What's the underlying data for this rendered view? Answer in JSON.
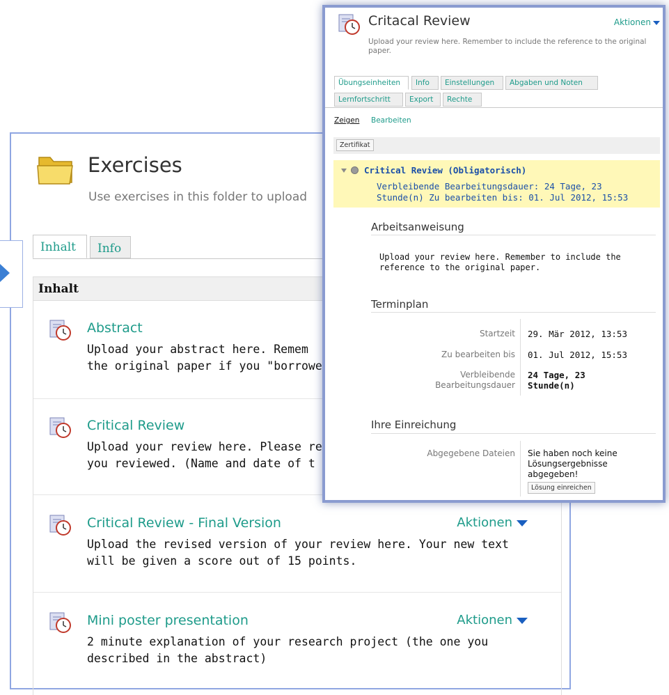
{
  "back_window": {
    "title": "Exercises",
    "description": "Use exercises in this folder to upload",
    "tabs": [
      {
        "label": "Inhalt",
        "active": true
      },
      {
        "label": "Info",
        "active": false
      }
    ],
    "list_header": "Inhalt",
    "items": [
      {
        "title": "Abstract",
        "description": "Upload your abstract here. Remem\nthe original paper if you \"borrowed\"",
        "actions": ""
      },
      {
        "title": "Critical Review",
        "description": "Upload your review here. Please re\nyou reviewed. (Name and date of t",
        "actions": ""
      },
      {
        "title": "Critical Review - Final Version",
        "description": "Upload the revised version of your review here. Your new text will be given a score out of 15 points.",
        "actions": "Aktionen"
      },
      {
        "title": "Mini poster presentation",
        "description": "2 minute explanation of your research project (the one you described in the abstract)",
        "actions": "Aktionen"
      }
    ]
  },
  "front_window": {
    "title": "Critacal Review",
    "actions_label": "Aktionen",
    "description": "Upload your review here. Remember to include the reference to the original paper.",
    "tabs_row1": [
      "Übungseinheiten",
      "Info",
      "Einstellungen",
      "Abgaben und Noten"
    ],
    "tabs_row2": [
      "Lernfortschritt",
      "Export",
      "Rechte"
    ],
    "subnav": {
      "show": "Zeigen",
      "edit": "Bearbeiten"
    },
    "certificate_button": "Zertifikat",
    "highlight": {
      "title": "Critical Review (Obligatorisch)",
      "line1": "Verbleibende Bearbeitungsdauer: 24 Tage, 23",
      "line2": "Stunde(n)  Zu bearbeiten bis: 01. Jul 2012, 15:53"
    },
    "instructions": {
      "heading": "Arbeitsanweisung",
      "text": "Upload your review here. Remember to include the reference to the original paper."
    },
    "schedule": {
      "heading": "Terminplan",
      "start_label": "Startzeit",
      "start_value": "29. Mär 2012, 13:53",
      "due_label": "Zu bearbeiten bis",
      "due_value": "01. Jul 2012, 15:53",
      "remaining_label_1": "Verbleibende",
      "remaining_label_2": "Bearbeitungsdauer",
      "remaining_value_1": "24 Tage, 23",
      "remaining_value_2": "Stunde(n)"
    },
    "submission": {
      "heading": "Ihre Einreichung",
      "files_label": "Abgegebene Dateien",
      "status_1": "Sie haben noch keine",
      "status_2": "Lösungsergebnisse",
      "status_3": "abgegeben!",
      "submit_button": "Lösung einreichen"
    }
  },
  "colors": {
    "link": "#1e9b8a",
    "highlight": "#fff8b8",
    "window_border": "#8a9bd0",
    "accent_blue": "#1a4fa8"
  }
}
